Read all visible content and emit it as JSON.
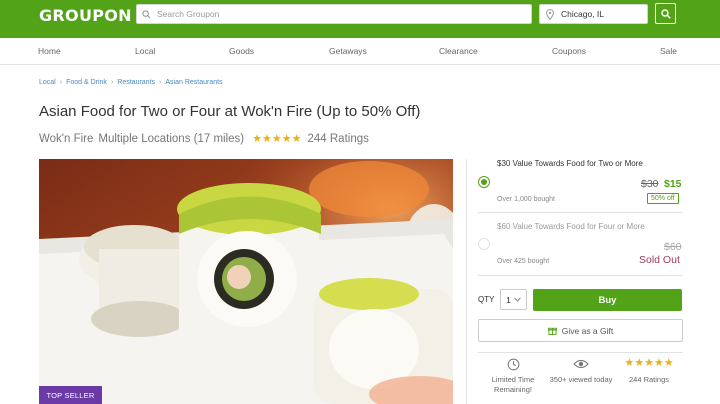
{
  "header": {
    "logo": "GROUPON",
    "search_placeholder": "Search Groupon",
    "location_value": "Chicago, IL"
  },
  "nav": {
    "items": [
      "Home",
      "Local",
      "Goods",
      "Getaways",
      "Clearance",
      "Coupons",
      "Sale"
    ]
  },
  "breadcrumb": [
    "Local",
    "Food & Drink",
    "Restaurants",
    "Asian Restaurants"
  ],
  "deal": {
    "title": "Asian Food for Two or Four at Wok'n Fire (Up to 50% Off)",
    "merchant": "Wok'n Fire",
    "locations": "Multiple Locations (17 miles)",
    "rating_stars": 5,
    "ratings_text": "244 Ratings",
    "badge": "TOP SELLER"
  },
  "options": [
    {
      "label": "$30 Value Towards Food for Two or More",
      "bought": "Over 1,000 bought",
      "old_price": "$30",
      "new_price": "$15",
      "discount": "50% off",
      "selected": true
    },
    {
      "label": "$60 Value Towards Food for Four or More",
      "bought": "Over 425 bought",
      "old_price": "$60",
      "status": "Sold Out",
      "selected": false
    }
  ],
  "purchase": {
    "qty_label": "QTY",
    "qty_value": "1",
    "buy_label": "Buy",
    "gift_label": "Give as a Gift"
  },
  "features": [
    {
      "icon": "clock-icon",
      "text": "Limited Time Remaining!"
    },
    {
      "icon": "eye-icon",
      "text": "350+ viewed today"
    },
    {
      "icon": "stars-icon",
      "text": "244 Ratings"
    }
  ],
  "colors": {
    "brand_green": "#53a318",
    "link_blue": "#4a88c4",
    "sold_out": "#a23a5c",
    "star": "#e8b21a",
    "top_seller": "#6b3aa7"
  }
}
